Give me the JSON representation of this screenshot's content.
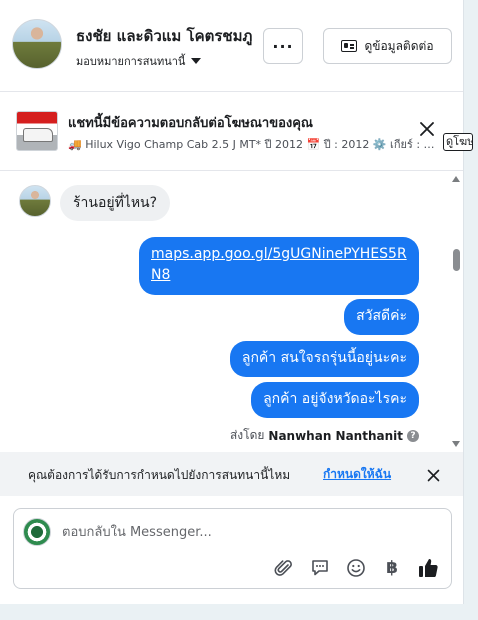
{
  "header": {
    "name": "ธงชัย และดิวแม โคตรชมภู",
    "assign_label": "มอบหมายการสนทนานี้",
    "more_label": "···",
    "contact_button": "ดูข้อมูลติดต่อ"
  },
  "ad": {
    "title": "แชทนี้มีข้อความตอบกลับต่อโฆษณาของคุณ",
    "detail": "🚚 Hilux Vigo Champ Cab 2.5 J MT* ปี 2012 📅 ปี : 2012 ⚙️ เกียร์ : ธรรมดา",
    "view_button": "ดูโฆษณา"
  },
  "messages": {
    "incoming": "ร้านอยู่ที่ไหน?",
    "outgoing": [
      "maps.app.goo.gl/5gUGNinePYHES5RN8",
      "สวัสดีค่ะ",
      "ลูกค้า  สนใจรถรุ่นนี้อยู่นะคะ",
      "ลูกค้า  อยู่จังหวัดอะไรคะ"
    ],
    "sent_by_prefix": "ส่งโดย",
    "sent_by_name": "Nanwhan Nanthanit"
  },
  "assign_bar": {
    "question": "คุณต้องการได้รับการกำหนดไปยังการสนทนานี้ไหม",
    "action": "กำหนดให้ฉัน"
  },
  "composer": {
    "placeholder": "ตอบกลับใน Messenger..."
  },
  "colors": {
    "accent": "#1877f2",
    "incoming_bubble": "#eef0f2",
    "assign_bar_bg": "#f1f3f5"
  }
}
